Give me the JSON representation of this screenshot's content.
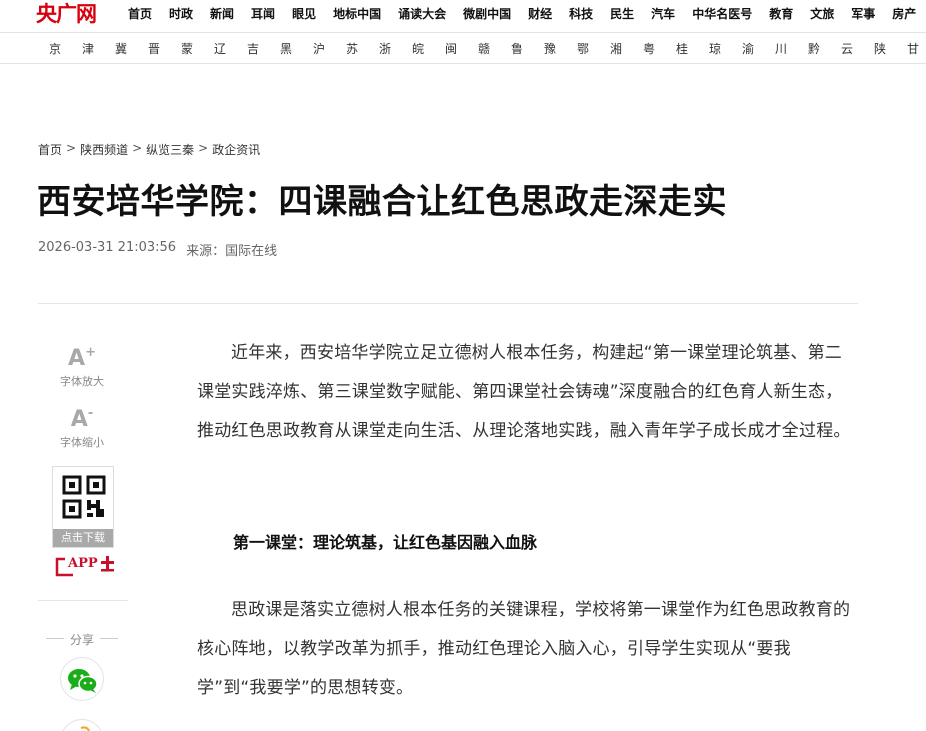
{
  "site": {
    "logo_text": "央广网",
    "nav": [
      "首页",
      "时政",
      "新闻",
      "耳闻",
      "眼见",
      "地标中国",
      "诵读大会",
      "微剧中国",
      "财经",
      "科技",
      "民生",
      "汽车",
      "中华名医号",
      "教育",
      "文旅",
      "军事",
      "房产"
    ],
    "provinces": [
      "京",
      "津",
      "冀",
      "晋",
      "蒙",
      "辽",
      "吉",
      "黑",
      "沪",
      "苏",
      "浙",
      "皖",
      "闽",
      "赣",
      "鲁",
      "豫",
      "鄂",
      "湘",
      "粤",
      "桂",
      "琼",
      "渝",
      "川",
      "黔",
      "云",
      "陕",
      "甘"
    ]
  },
  "breadcrumb": [
    "首页",
    "陕西频道",
    "纵览三秦",
    "政企资讯"
  ],
  "breadcrumb_sep": ">",
  "article": {
    "title": "西安培华学院：四课融合让红色思政走深走实",
    "datetime": "2026-03-31 21:03:56",
    "source": "来源：国际在线",
    "paragraph1": "近年来，西安培华学院立足立德树人根本任务，构建起“第一课堂理论筑基、第二课堂实践淬炼、第三课堂数字赋能、第四课堂社会铸魂”深度融合的红色育人新生态，推动红色思政教育从课堂走向生活、从理论落地实践，融入青年学子成长成才全过程。",
    "subheading1": "第一课堂：理论筑基，让红色基因融入血脉",
    "paragraph2": "思政课是落实立德树人根本任务的关键课程，学校将第一课堂作为红色思政教育的核心阵地，以教学改革为抓手，推动红色理论入脑入心，引导学生实现从“要我学”到“我要学”的思想转变。"
  },
  "tools": {
    "font_up_glyph": "A",
    "font_up_sup": "+",
    "font_up_label": "字体放大",
    "font_down_glyph": "A",
    "font_down_sup": "-",
    "font_down_label": "字体缩小",
    "download_label": "点击下载",
    "app_label": "APP",
    "share_label": "分享"
  },
  "colors": {
    "brand_red": "#d7000f",
    "wechat_green": "#1aad19"
  }
}
